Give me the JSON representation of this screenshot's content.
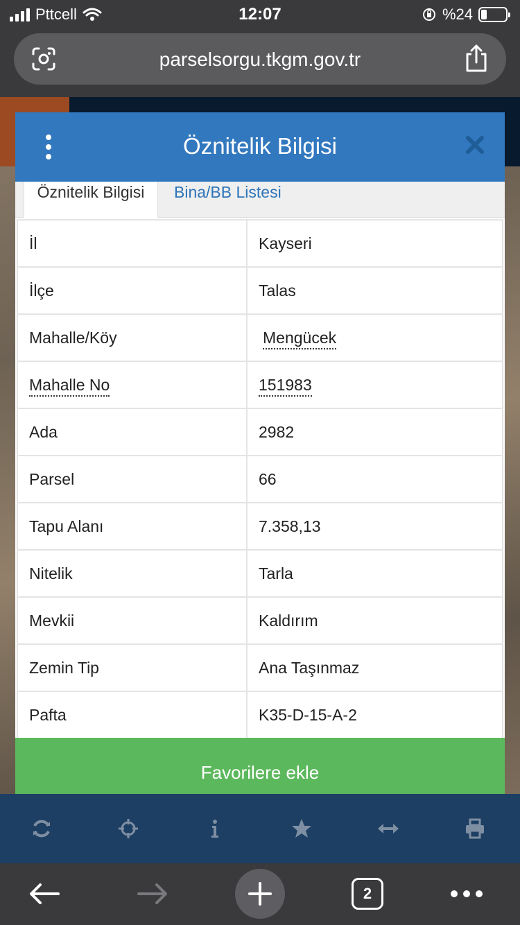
{
  "status_bar": {
    "carrier": "Pttcell",
    "time": "12:07",
    "battery": "%24",
    "battery_level": 0.24
  },
  "browser": {
    "url": "parselsorgu.tkgm.gov.tr",
    "tabs_count": "2"
  },
  "dialog": {
    "title": "Öznitelik Bilgisi",
    "tabs": [
      {
        "label": "Öznitelik Bilgisi"
      },
      {
        "label": "Bina/BB Listesi"
      }
    ],
    "rows": [
      {
        "key": "İl",
        "value": "Kayseri"
      },
      {
        "key": "İlçe",
        "value": "Talas"
      },
      {
        "key": "Mahalle/Köy",
        "value": "Mengücek"
      },
      {
        "key": "Mahalle No",
        "value": "151983"
      },
      {
        "key": "Ada",
        "value": "2982"
      },
      {
        "key": "Parsel",
        "value": "66"
      },
      {
        "key": "Tapu Alanı",
        "value": "7.358,13"
      },
      {
        "key": "Nitelik",
        "value": "Tarla"
      },
      {
        "key": "Mevkii",
        "value": "Kaldırım"
      },
      {
        "key": "Zemin Tip",
        "value": "Ana Taşınmaz"
      },
      {
        "key": "Pafta",
        "value": "K35-D-15-A-2"
      }
    ],
    "favorite_button": "Favorilere ekle"
  },
  "map_toolbar": [
    "refresh-icon",
    "locate-icon",
    "info-icon",
    "star-icon",
    "measure-icon",
    "print-icon"
  ],
  "colors": {
    "header_blue": "#3278bf",
    "link_blue": "#2d74b8",
    "button_green": "#5cb85c",
    "toolbar_navy": "#1d3f63"
  }
}
